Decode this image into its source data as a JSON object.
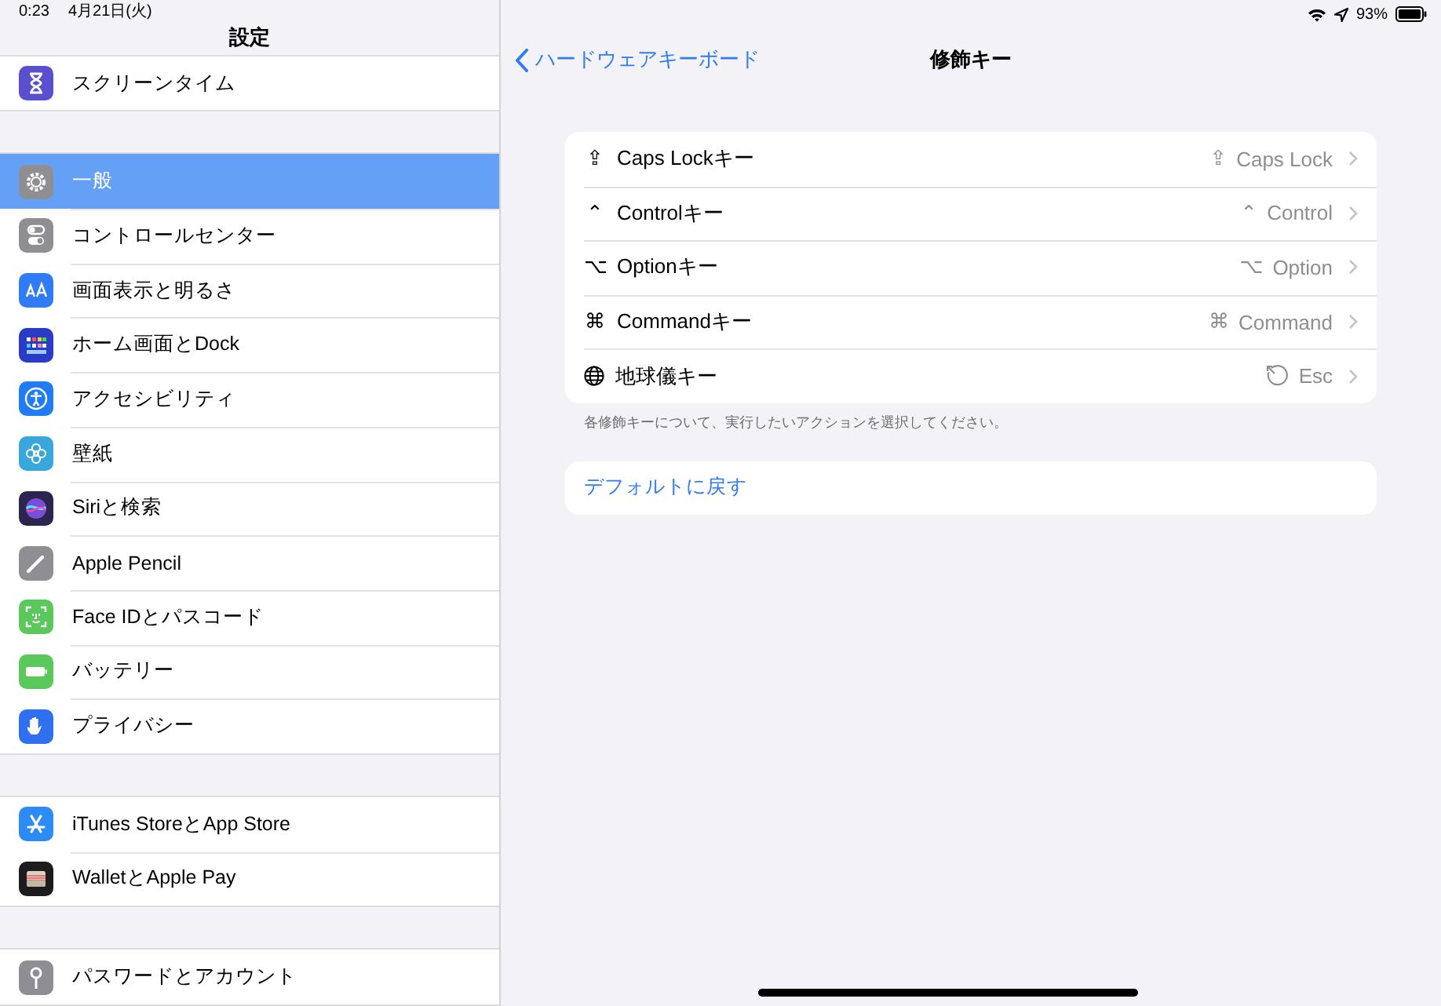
{
  "status_bar": {
    "time": "0:23",
    "date": "4月21日(火)",
    "battery": "93%"
  },
  "sidebar": {
    "title": "設定",
    "groups": [
      [
        {
          "label": "スクリーンタイム",
          "color": "#5a4fcf",
          "selected": false
        }
      ],
      [
        {
          "label": "一般",
          "color": "#8e8e93",
          "selected": true
        },
        {
          "label": "コントロールセンター",
          "color": "#8e8e93",
          "selected": false
        },
        {
          "label": "画面表示と明るさ",
          "color": "#2f7cf6",
          "selected": false
        },
        {
          "label": "ホーム画面とDock",
          "color": "#2a3cc7",
          "selected": false
        },
        {
          "label": "アクセシビリティ",
          "color": "#1f7cf5",
          "selected": false
        },
        {
          "label": "壁紙",
          "color": "#3aa7dc",
          "selected": false
        },
        {
          "label": "Siriと検索",
          "color": "#2b2550",
          "selected": false
        },
        {
          "label": "Apple Pencil",
          "color": "#8e8e93",
          "selected": false
        },
        {
          "label": "Face IDとパスコード",
          "color": "#5ac85a",
          "selected": false
        },
        {
          "label": "バッテリー",
          "color": "#5ac85a",
          "selected": false
        },
        {
          "label": "プライバシー",
          "color": "#2f6ff0",
          "selected": false
        }
      ],
      [
        {
          "label": "iTunes StoreとApp Store",
          "color": "#2d8cf4",
          "selected": false
        },
        {
          "label": "WalletとApple Pay",
          "color": "#1c1c1e",
          "selected": false
        }
      ],
      [
        {
          "label": "パスワードとアカウント",
          "color": "#8e8e93",
          "selected": false
        }
      ]
    ]
  },
  "detail": {
    "back": "ハードウェアキーボード",
    "title": "修飾キー",
    "rows": [
      {
        "symbol": "⇪",
        "label": "Caps Lockキー",
        "value_symbol": "⇪",
        "value": "Caps Lock"
      },
      {
        "symbol": "⌃",
        "label": "Controlキー",
        "value_symbol": "⌃",
        "value": "Control"
      },
      {
        "symbol": "⌥",
        "label": "Optionキー",
        "value_symbol": "⌥",
        "value": "Option"
      },
      {
        "symbol": "⌘",
        "label": "Commandキー",
        "value_symbol": "⌘",
        "value": "Command"
      },
      {
        "label": "地球儀キー",
        "value": "Esc"
      }
    ],
    "footer": "各修飾キーについて、実行したいアクションを選択してください。",
    "reset": "デフォルトに戻す"
  }
}
